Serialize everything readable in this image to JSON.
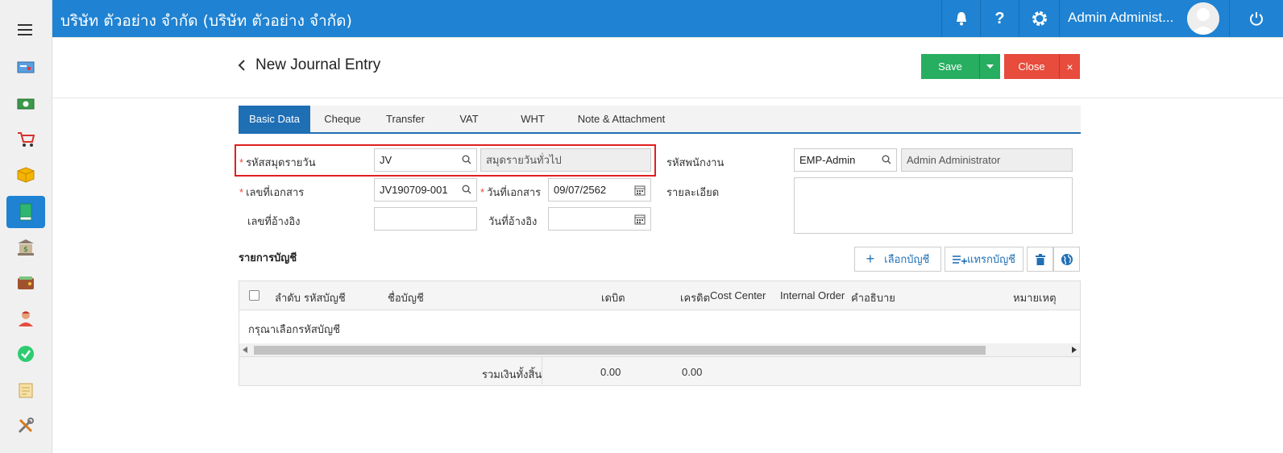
{
  "header": {
    "company": "บริษัท ตัวอย่าง จำกัด (บริษัท ตัวอย่าง จำกัด)",
    "username": "Admin Administ..."
  },
  "page": {
    "title": "New Journal Entry",
    "save_label": "Save",
    "close_label": "Close"
  },
  "tabs": [
    "Basic Data",
    "Cheque",
    "Transfer",
    "VAT",
    "WHT",
    "Note & Attachment"
  ],
  "form": {
    "journal_code_label": "รหัสสมุดรายวัน",
    "journal_code_value": "JV",
    "journal_name_value": "สมุดรายวันทั่วไป",
    "doc_no_label": "เลขที่เอกสาร",
    "doc_no_value": "JV190709-001",
    "doc_date_label": "วันที่เอกสาร",
    "doc_date_value": "09/07/2562",
    "ref_no_label": "เลขที่อ้างอิง",
    "ref_no_value": "",
    "ref_date_label": "วันที่อ้างอิง",
    "ref_date_value": "",
    "employee_label": "รหัสพนักงาน",
    "employee_code_value": "EMP-Admin",
    "employee_name_value": "Admin Administrator",
    "detail_label": "รายละเอียด",
    "detail_value": ""
  },
  "accounts": {
    "section_title": "รายการบัญชี",
    "select_button": "เลือกบัญชี",
    "insert_button": "แทรกบัญชี",
    "columns": [
      "ลำดับ",
      "รหัสบัญชี",
      "ชื่อบัญชี",
      "เดบิต",
      "เครดิต",
      "Cost Center",
      "Internal Order",
      "คำอธิบาย",
      "หมายเหตุ"
    ],
    "empty_message": "กรุณาเลือกรหัสบัญชี",
    "total_label": "รวมเงินทั้งสิ้น",
    "total_debit": "0.00",
    "total_credit": "0.00"
  },
  "colors": {
    "primary": "#1f82d2",
    "save": "#27ae60",
    "close": "#e74c3c",
    "highlight": "#e02020"
  }
}
